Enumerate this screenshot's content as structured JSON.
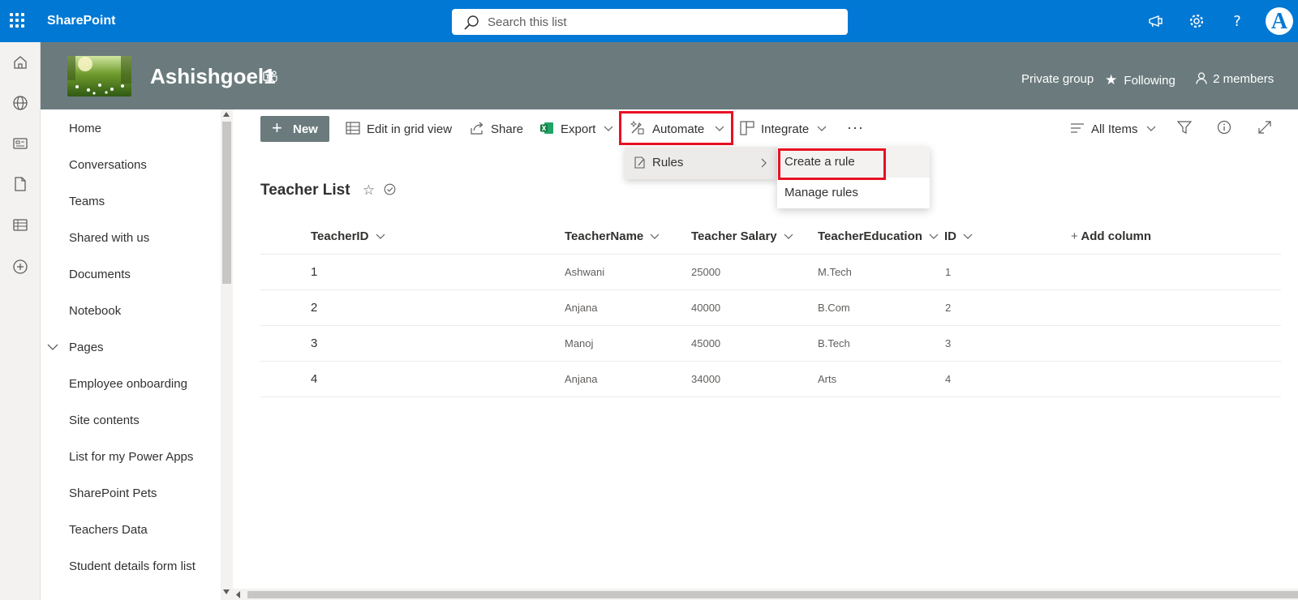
{
  "suite_bar": {
    "app_name": "SharePoint",
    "search_placeholder": "Search this list",
    "avatar_initial": "A"
  },
  "site": {
    "title": "Ashishgoel1",
    "privacy": "Private group",
    "following_label": "Following",
    "members_label": "2 members"
  },
  "left_nav": {
    "items": [
      "Home",
      "Conversations",
      "Teams",
      "Shared with us",
      "Documents",
      "Notebook",
      "Pages",
      "Employee onboarding",
      "Site contents",
      "List for my Power Apps",
      "SharePoint Pets",
      "Teachers Data",
      "Student details form list"
    ]
  },
  "command_bar": {
    "new_label": "New",
    "edit_grid_label": "Edit in grid view",
    "share_label": "Share",
    "export_label": "Export",
    "automate_label": "Automate",
    "integrate_label": "Integrate",
    "more_label": "···",
    "view_label": "All Items"
  },
  "automate_menu": {
    "rules_label": "Rules",
    "submenu": [
      "Create a rule",
      "Manage rules"
    ]
  },
  "list": {
    "title": "Teacher List",
    "columns": [
      "TeacherID",
      "TeacherName",
      "Teacher Salary",
      "TeacherEducation",
      "ID"
    ],
    "add_column_label": "Add column",
    "rows": [
      [
        "1",
        "Ashwani",
        "25000",
        "M.Tech",
        "1"
      ],
      [
        "2",
        "Anjana",
        "40000",
        "B.Com",
        "2"
      ],
      [
        "3",
        "Manoj",
        "45000",
        "B.Tech",
        "3"
      ],
      [
        "4",
        "Anjana",
        "34000",
        "Arts",
        "4"
      ]
    ]
  },
  "colors": {
    "suite_bar": "#0078d4",
    "site_header": "#6b7b7d",
    "highlight": "#e81123",
    "excel_green": "#107c41"
  },
  "icons": {
    "rail": [
      "home-icon",
      "globe-icon",
      "news-icon",
      "document-icon",
      "list-icon",
      "add-icon"
    ],
    "suite_bar": [
      "megaphone-icon",
      "gear-icon",
      "help-icon"
    ]
  }
}
